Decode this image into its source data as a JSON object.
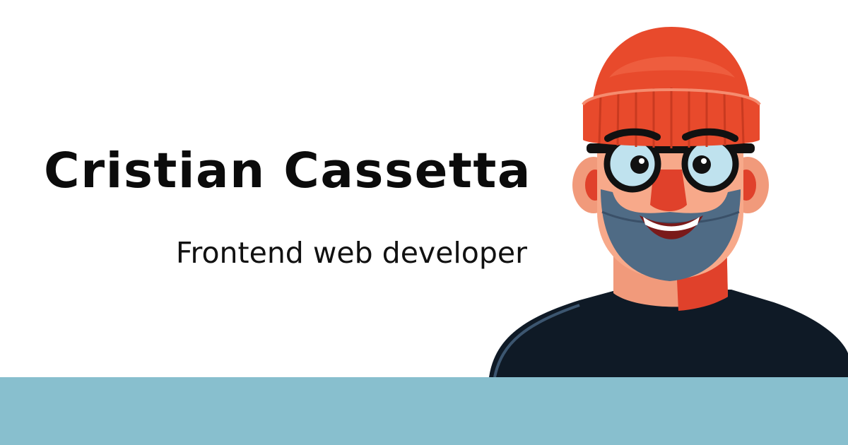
{
  "hero": {
    "name": "Cristian Cassetta",
    "role": "Frontend web developer"
  },
  "avatar": {
    "icon": "illustrated-portrait-avatar"
  },
  "colors": {
    "background": "#ffffff",
    "band": "#88bfce",
    "text": "#0b0b0b",
    "beanie": "#e84a2c",
    "skin": "#f7a98a",
    "beard": "#4f6b85",
    "shirt": "#0f1a26"
  }
}
